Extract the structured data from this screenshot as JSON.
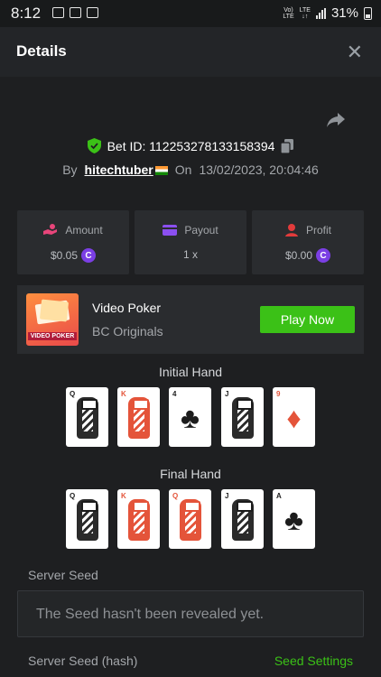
{
  "status_bar": {
    "time": "8:12",
    "network_top": "Vo)",
    "network_bottom": "LTE",
    "lte_label": "LTE",
    "battery_percent": "31%"
  },
  "header": {
    "title": "Details",
    "close_glyph": "✕"
  },
  "bet": {
    "id_label": "Bet ID: 112253278133158394",
    "by_label": "By",
    "username": "hitechtuber",
    "on_label": "On",
    "timestamp": "13/02/2023, 20:04:46"
  },
  "stats": [
    {
      "label": "Amount",
      "value": "$0.05",
      "icon": "money-hand-icon",
      "has_coin": true,
      "icon_color": "#e8457a"
    },
    {
      "label": "Payout",
      "value": "1 x",
      "icon": "card-icon",
      "has_coin": false,
      "icon_color": "#8b4ff0"
    },
    {
      "label": "Profit",
      "value": "$0.00",
      "icon": "person-profit-icon",
      "has_coin": true,
      "icon_color": "#e23b3b"
    }
  ],
  "coin_glyph": "C",
  "game": {
    "name": "Video Poker",
    "provider": "BC Originals",
    "thumb_label": "VIDEO POKER",
    "play_label": "Play Now"
  },
  "initial_hand": {
    "title": "Initial Hand",
    "cards": [
      {
        "rank": "Q",
        "suit": "♣",
        "color": "black",
        "face": true
      },
      {
        "rank": "K",
        "suit": "♥",
        "color": "red",
        "face": true
      },
      {
        "rank": "4",
        "suit": "♣",
        "color": "black",
        "face": false
      },
      {
        "rank": "J",
        "suit": "♣",
        "color": "black",
        "face": true
      },
      {
        "rank": "9",
        "suit": "♦",
        "color": "red",
        "face": false
      }
    ]
  },
  "final_hand": {
    "title": "Final Hand",
    "cards": [
      {
        "rank": "Q",
        "suit": "♣",
        "color": "black",
        "face": true
      },
      {
        "rank": "K",
        "suit": "♥",
        "color": "red",
        "face": true
      },
      {
        "rank": "Q",
        "suit": "♦",
        "color": "red",
        "face": true
      },
      {
        "rank": "J",
        "suit": "♣",
        "color": "black",
        "face": true
      },
      {
        "rank": "A",
        "suit": "♣",
        "color": "black",
        "face": false
      }
    ]
  },
  "server_seed": {
    "label": "Server Seed",
    "placeholder_text": "The Seed hasn't been revealed yet.",
    "hash_label": "Server Seed (hash)",
    "settings_link": "Seed Settings"
  },
  "colors": {
    "accent_green": "#3bc117",
    "coin_purple": "#7b3fe4",
    "shield_green": "#3bc117"
  }
}
